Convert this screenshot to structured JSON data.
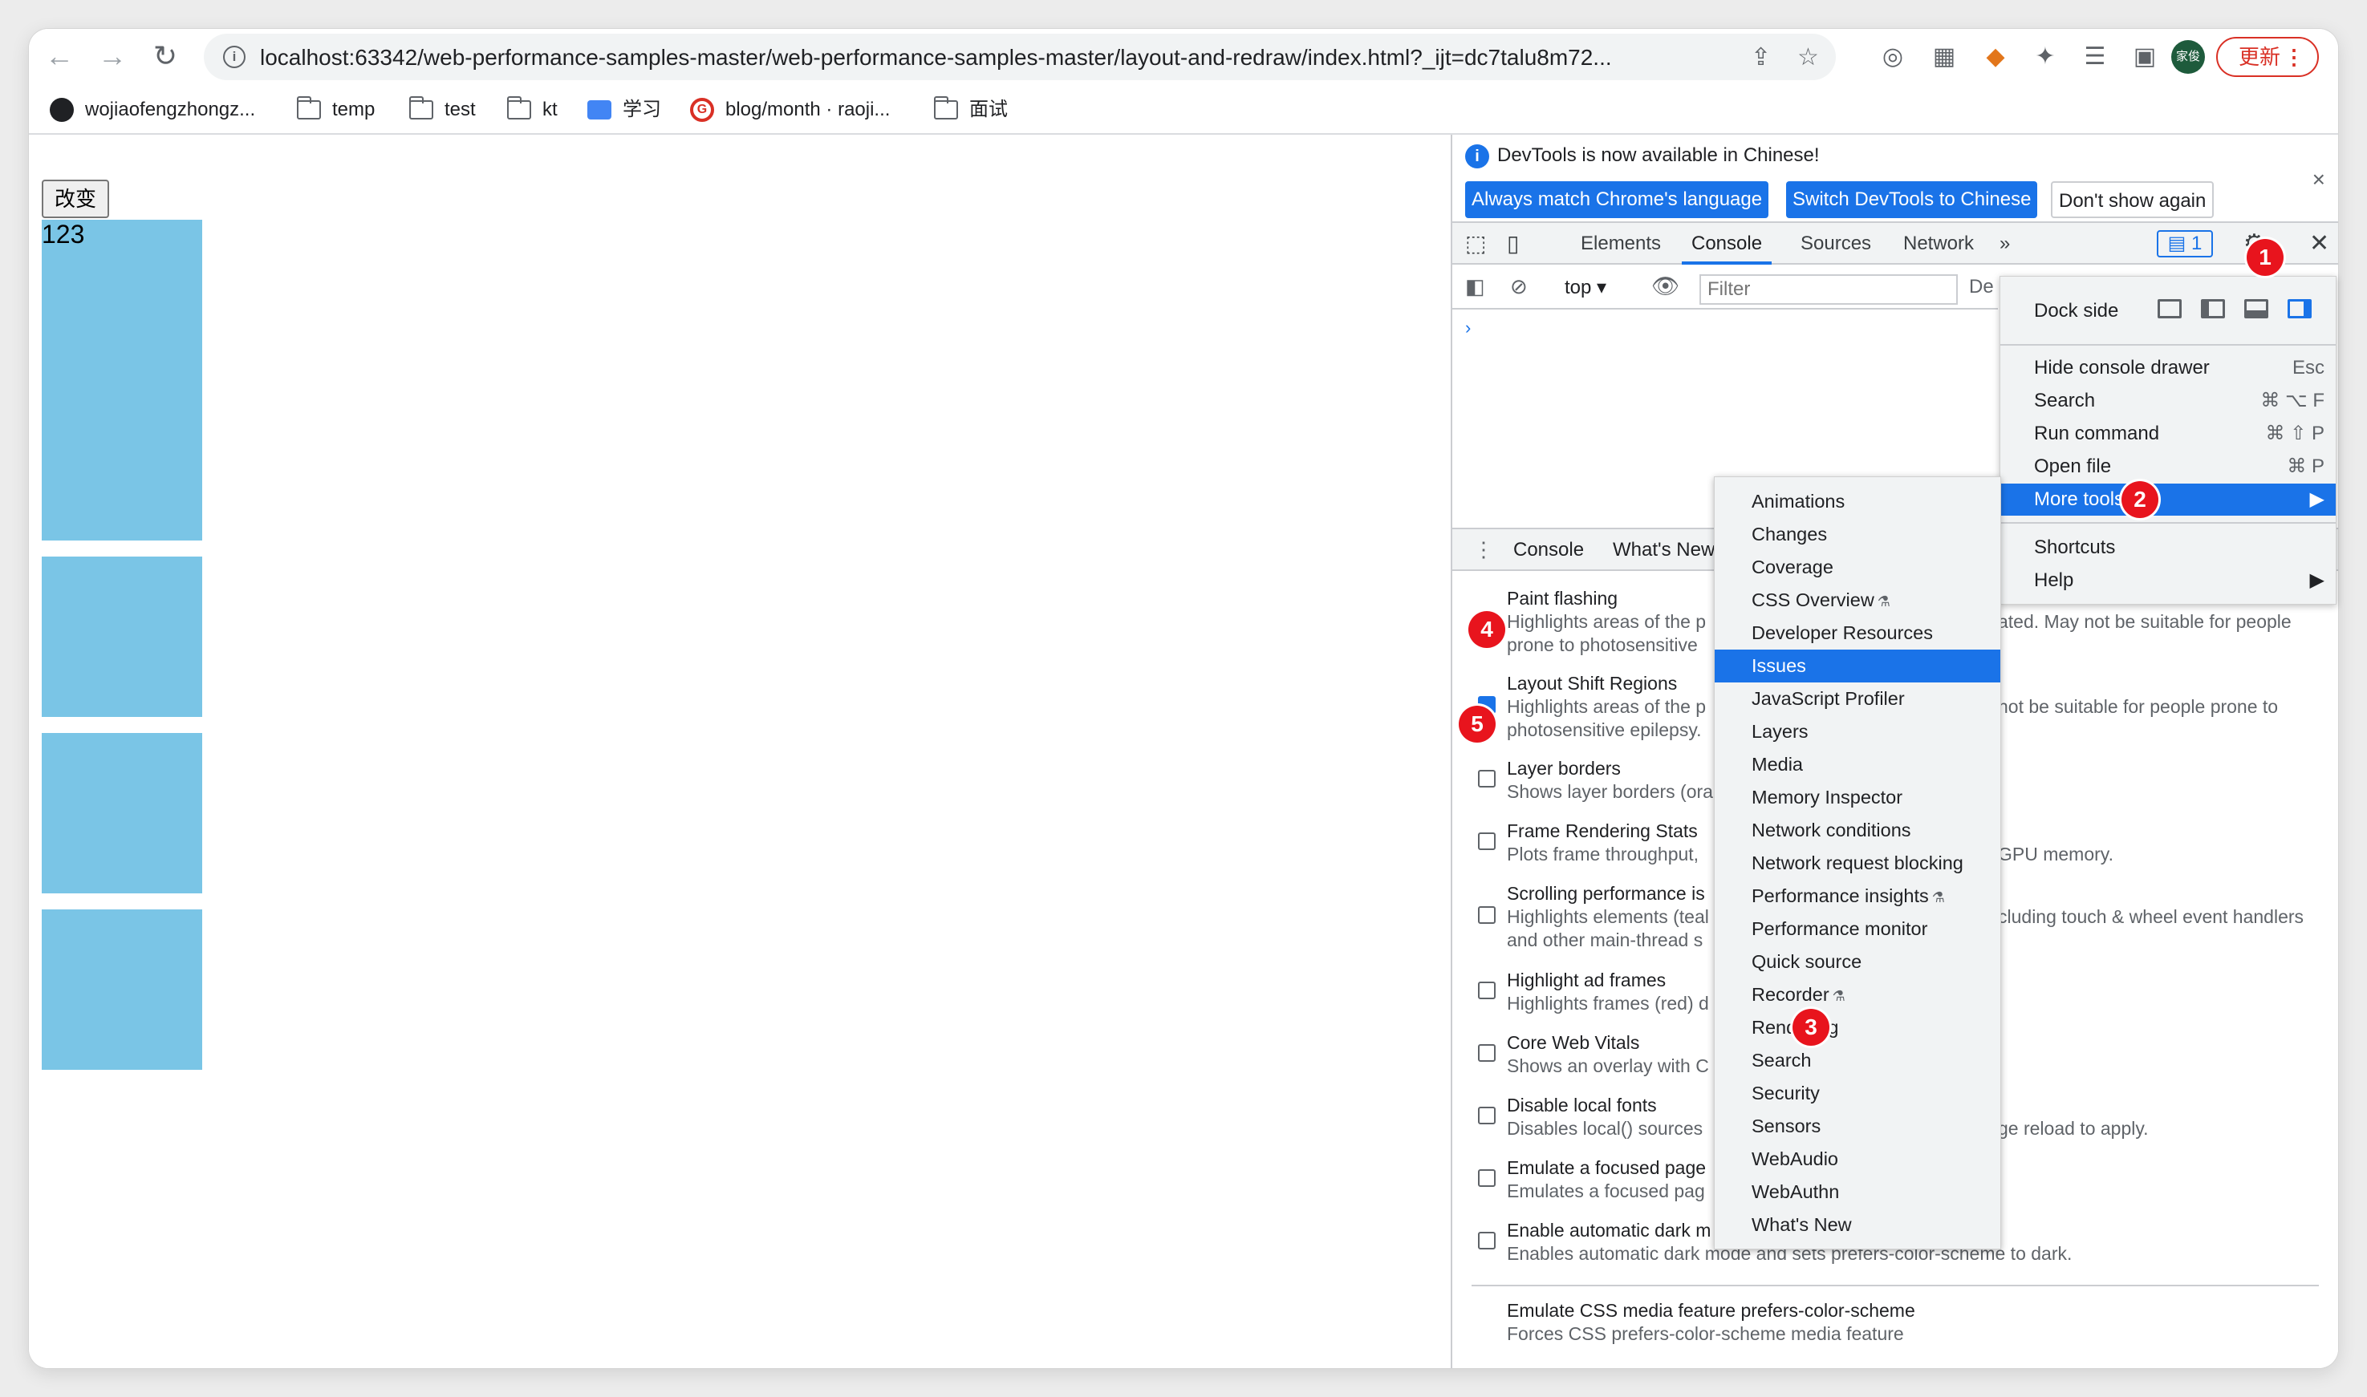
{
  "browser": {
    "url": "localhost:63342/web-performance-samples-master/web-performance-samples-master/layout-and-redraw/index.html?_ijt=dc7talu8m72...",
    "avatar_text": "家俊",
    "update_label": "更新"
  },
  "bookmarks": [
    {
      "label": "wojiaofengzhongz...",
      "icon": "github-icon"
    },
    {
      "label": "temp",
      "icon": "folder-icon"
    },
    {
      "label": "test",
      "icon": "folder-icon"
    },
    {
      "label": "kt",
      "icon": "folder-icon"
    },
    {
      "label": "学习",
      "icon": "cube-icon"
    },
    {
      "label": "blog/month · raoji...",
      "icon": "g-logo-icon"
    },
    {
      "label": "面试",
      "icon": "folder-icon"
    }
  ],
  "page": {
    "button_label": "改变",
    "block_text": "123"
  },
  "devtools": {
    "info_message": "DevTools is now available in Chinese!",
    "info_buttons": [
      "Always match Chrome's language",
      "Switch DevTools to Chinese",
      "Don't show again"
    ],
    "tabs": [
      "Elements",
      "Console",
      "Sources",
      "Network"
    ],
    "issues_count": "1",
    "console_context": "top",
    "filter_placeholder": "Filter",
    "default_levels_stub": "De",
    "drawer_tabs": [
      "Console",
      "What's New"
    ],
    "rendering_options": [
      {
        "title": "Paint flashing",
        "desc": "Highlights areas of the p",
        "desc_right": "ated. May not be suitable for people",
        "desc2": "prone to photosensitive"
      },
      {
        "title": "Layout Shift Regions",
        "desc": "Highlights areas of the p",
        "desc_right": "not be suitable for people prone to",
        "desc2": "photosensitive epilepsy."
      },
      {
        "title": "Layer borders",
        "desc": "Shows layer borders (ora",
        "desc_right": "",
        "desc2": ""
      },
      {
        "title": "Frame Rendering Stats",
        "desc": "Plots frame throughput,",
        "desc_right": "GPU memory.",
        "desc2": ""
      },
      {
        "title": "Scrolling performance is",
        "desc": "Highlights elements (teal",
        "desc_right": "cluding touch & wheel event handlers",
        "desc2": "and other main-thread s"
      },
      {
        "title": "Highlight ad frames",
        "desc": "Highlights frames (red) d",
        "desc_right": "",
        "desc2": ""
      },
      {
        "title": "Core Web Vitals",
        "desc": "Shows an overlay with C",
        "desc_right": "",
        "desc2": ""
      },
      {
        "title": "Disable local fonts",
        "desc": "Disables local() sources",
        "desc_right": "ge reload to apply.",
        "desc2": ""
      },
      {
        "title": "Emulate a focused page",
        "desc": "Emulates a focused pag",
        "desc_right": "",
        "desc2": ""
      },
      {
        "title": "Enable automatic dark m",
        "desc": "Enables automatic dark mode and sets prefers-color-scheme to dark.",
        "desc_right": "",
        "desc2": ""
      }
    ],
    "media_feature": {
      "title": "Emulate CSS media feature prefers-color-scheme",
      "desc": "Forces CSS prefers-color-scheme media feature"
    }
  },
  "settings_menu": {
    "dock_side": "Dock side",
    "items": [
      {
        "label": "Hide console drawer",
        "key": "Esc"
      },
      {
        "label": "Search",
        "key": "⌘ ⌥ F"
      },
      {
        "label": "Run command",
        "key": "⌘ ⇧ P"
      },
      {
        "label": "Open file",
        "key": "⌘ P"
      },
      {
        "label": "More tools",
        "key": "▶"
      },
      {
        "label": "Shortcuts",
        "key": ""
      },
      {
        "label": "Help",
        "key": "▶"
      }
    ]
  },
  "more_tools": [
    {
      "label": "Animations"
    },
    {
      "label": "Changes"
    },
    {
      "label": "Coverage"
    },
    {
      "label": "CSS Overview",
      "flask": true
    },
    {
      "label": "Developer Resources"
    },
    {
      "label": "Issues",
      "selected": true
    },
    {
      "label": "JavaScript Profiler"
    },
    {
      "label": "Layers"
    },
    {
      "label": "Media"
    },
    {
      "label": "Memory Inspector"
    },
    {
      "label": "Network conditions"
    },
    {
      "label": "Network request blocking"
    },
    {
      "label": "Performance insights",
      "flask": true
    },
    {
      "label": "Performance monitor"
    },
    {
      "label": "Quick source"
    },
    {
      "label": "Recorder",
      "flask": true
    },
    {
      "label": "Rendering"
    },
    {
      "label": "Search"
    },
    {
      "label": "Security"
    },
    {
      "label": "Sensors"
    },
    {
      "label": "WebAudio"
    },
    {
      "label": "WebAuthn"
    },
    {
      "label": "What's New"
    }
  ],
  "annotations": [
    "1",
    "2",
    "3",
    "4",
    "5"
  ],
  "colors": {
    "accent": "#1a73e8",
    "badge": "#e8141d",
    "block": "#7ac5e6"
  }
}
